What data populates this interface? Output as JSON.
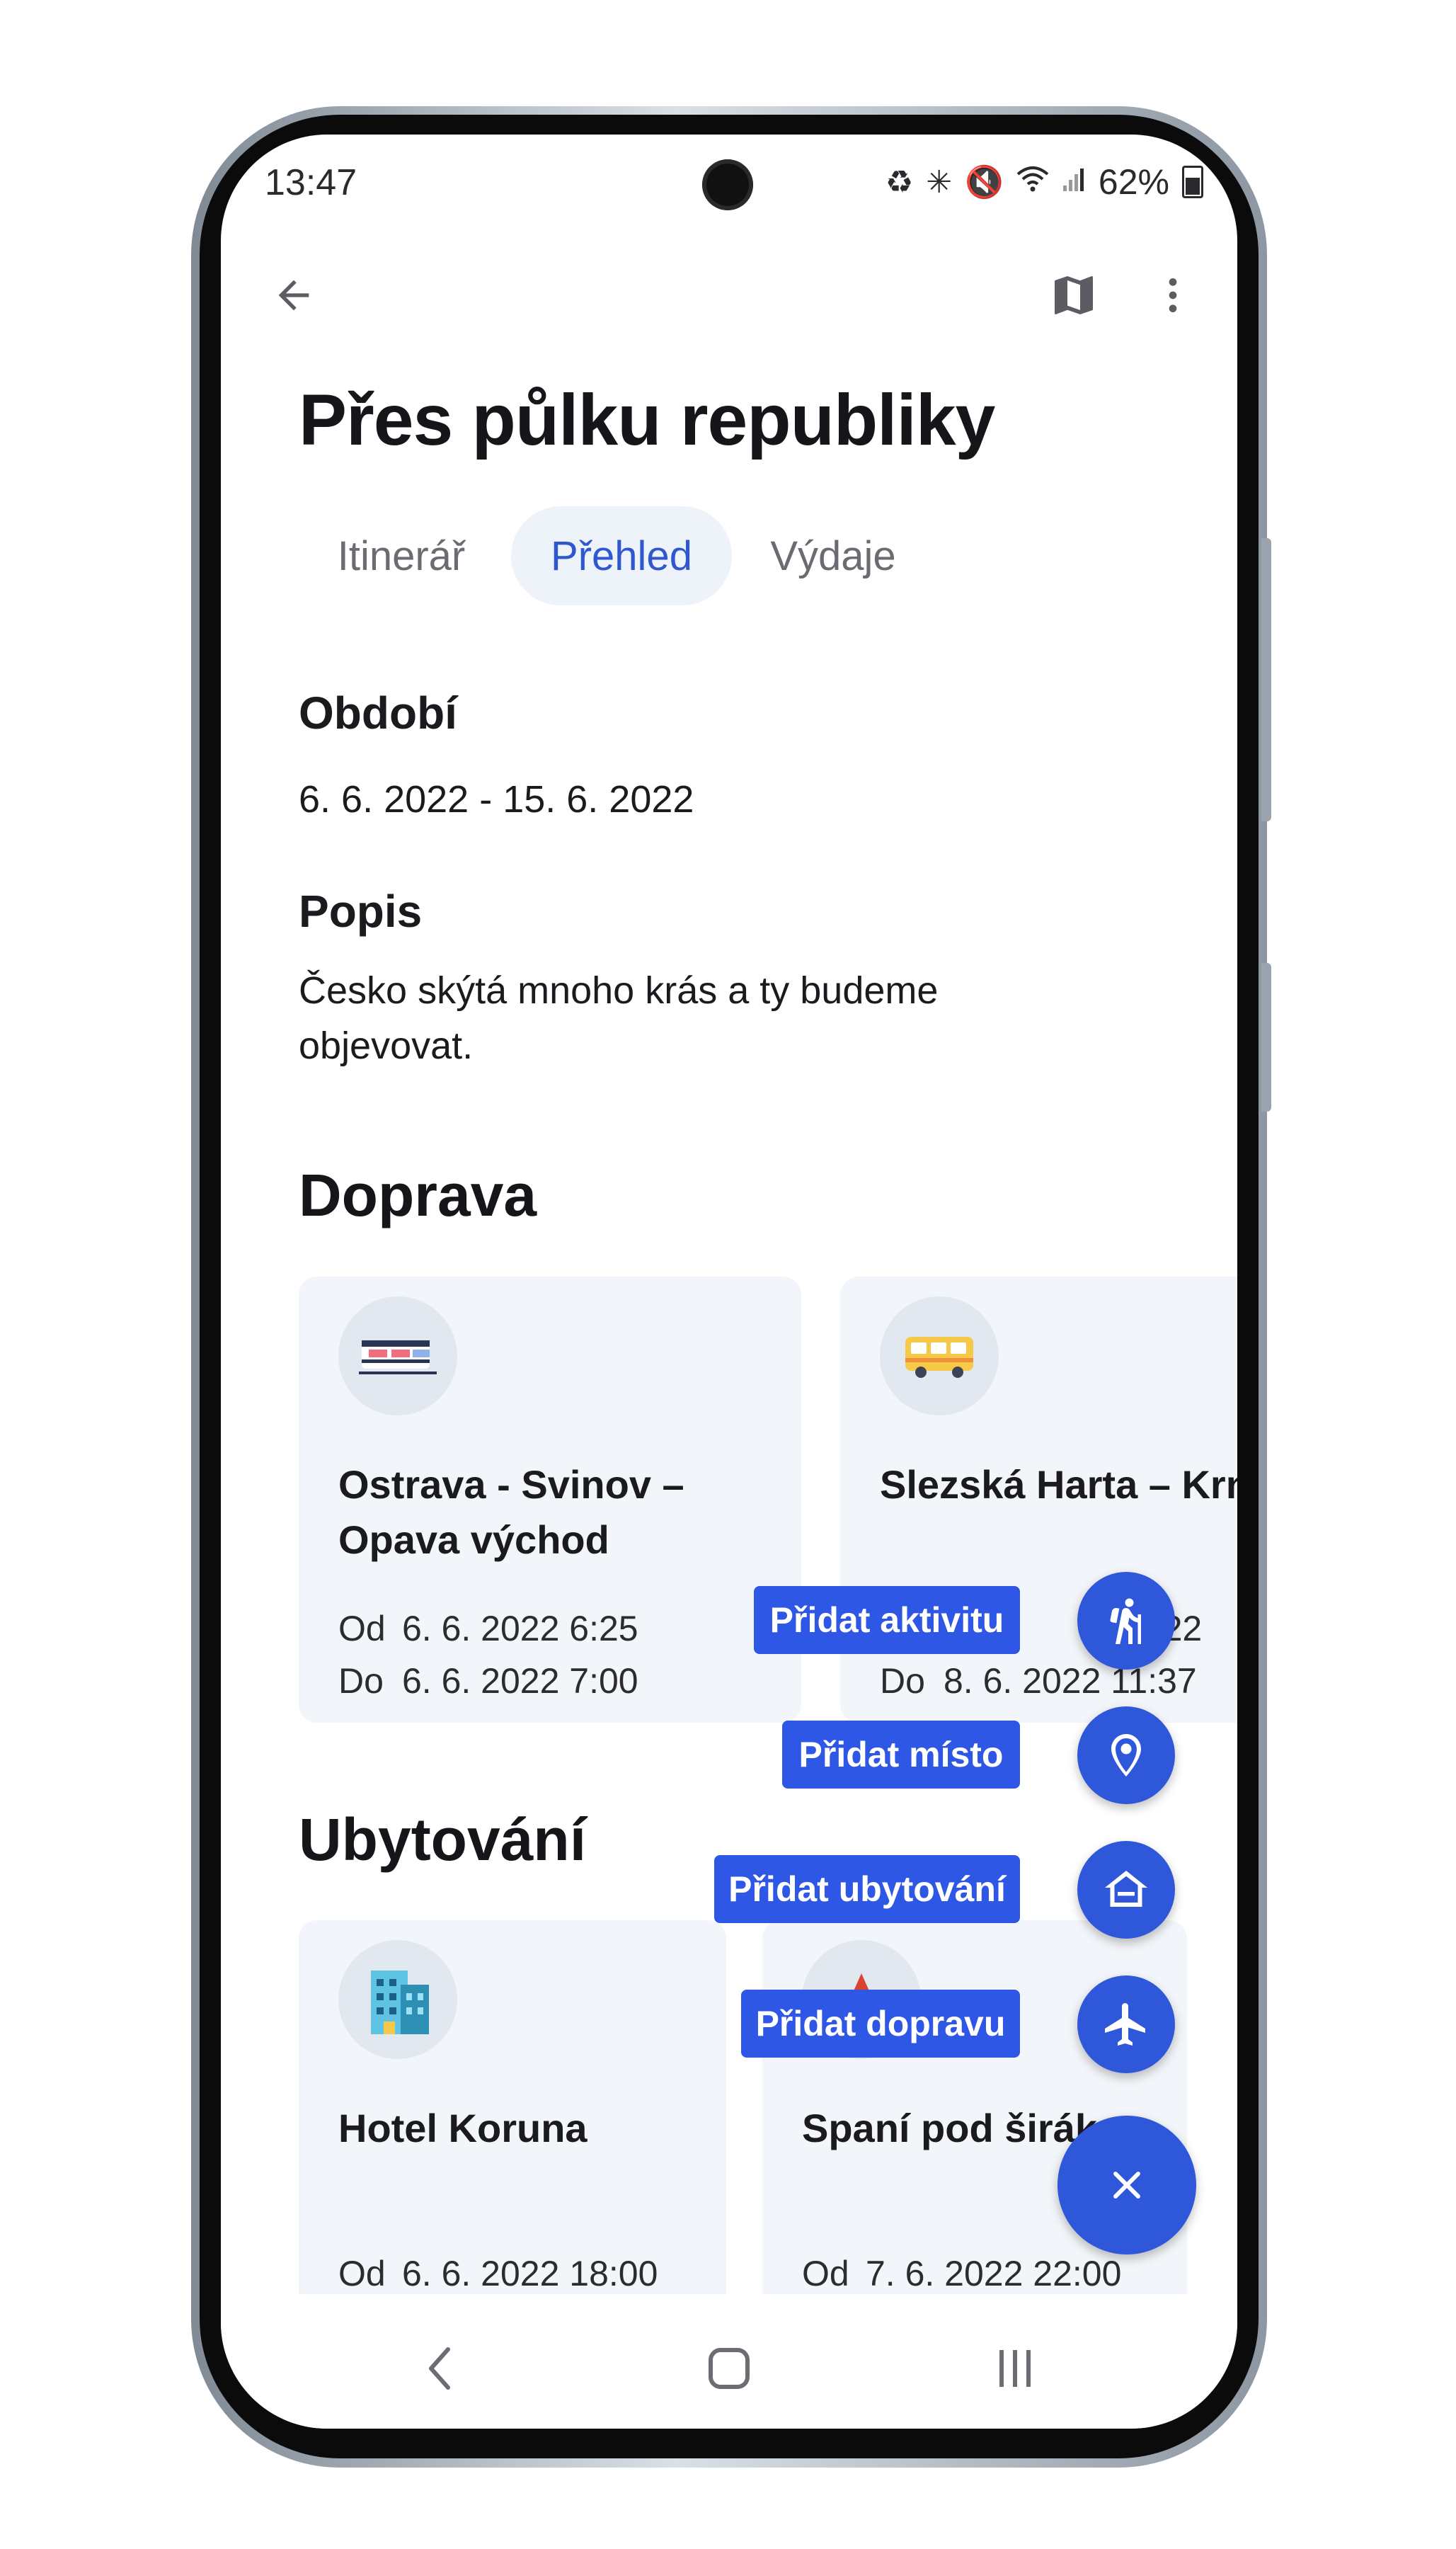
{
  "status_bar": {
    "time": "13:47",
    "battery": "62%"
  },
  "toolbar": {
    "back_icon": "arrow-left-icon",
    "map_icon": "map-icon",
    "more_icon": "more-vert-icon"
  },
  "trip": {
    "title": "Přes půlku republiky"
  },
  "tabs": [
    {
      "label": "Itinerář",
      "active": false
    },
    {
      "label": "Přehled",
      "active": true
    },
    {
      "label": "Výdaje",
      "active": false
    }
  ],
  "overview": {
    "period_label": "Období",
    "period_value": "6. 6. 2022 - 15. 6. 2022",
    "description_label": "Popis",
    "description_value": "Česko skýtá mnoho krás a ty budeme objevovat."
  },
  "transport": {
    "heading": "Doprava",
    "cards": [
      {
        "icon": "train-icon",
        "title": "Ostrava - Svinov – Opava východ",
        "from_label": "Od",
        "from_value": "6. 6. 2022 6:25",
        "to_label": "Do",
        "to_value": "6. 6. 2022 7:00"
      },
      {
        "icon": "bus-icon",
        "title": "Slezská Harta – Krno",
        "from_label": "Od",
        "from_value": "2022",
        "to_label": "Do",
        "to_value": "8. 6. 2022 11:37"
      }
    ]
  },
  "accommodation": {
    "heading": "Ubytování",
    "cards": [
      {
        "icon": "hotel-icon",
        "title": "Hotel Koruna",
        "from_label": "Od",
        "from_value": "6. 6. 2022 18:00"
      },
      {
        "icon": "tent-icon",
        "title": "Spaní pod širákem",
        "from_label": "Od",
        "from_value": "7. 6. 2022 22:00"
      }
    ]
  },
  "speed_dial": {
    "actions": [
      {
        "label": "Přidat aktivitu",
        "icon": "hiking-icon"
      },
      {
        "label": "Přidat místo",
        "icon": "location-pin-icon"
      },
      {
        "label": "Přidat ubytování",
        "icon": "house-icon"
      },
      {
        "label": "Přidat dopravu",
        "icon": "airplane-icon"
      }
    ],
    "close_icon": "close-icon"
  },
  "nav_bar": {
    "back_icon": "nav-back-icon",
    "home_icon": "nav-home-icon",
    "recents_icon": "nav-recents-icon"
  },
  "colors": {
    "accent": "#2f57d9",
    "tab_active_bg": "#eef3fa",
    "card_bg": "#f2f5f9"
  }
}
